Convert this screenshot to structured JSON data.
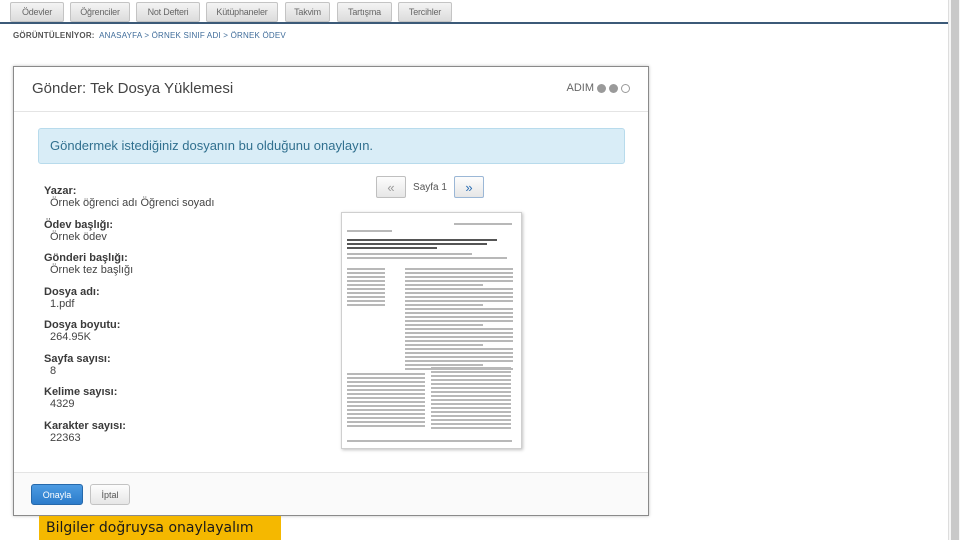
{
  "nav": {
    "tabs": [
      {
        "label": "Ödevler"
      },
      {
        "label": "Öğrenciler"
      },
      {
        "label": "Not Defteri"
      },
      {
        "label": "Kütüphaneler"
      },
      {
        "label": "Takvim"
      },
      {
        "label": "Tartışma"
      },
      {
        "label": "Tercihler"
      }
    ]
  },
  "breadcrumb": {
    "status": "GÖRÜNTÜLENİYOR:",
    "path": "ANASAYFA > ÖRNEK SINIF ADI > ÖRNEK ÖDEV"
  },
  "modal": {
    "title": "Gönder: Tek Dosya Yüklemesi",
    "step_label": "ADIM",
    "step_current": 2,
    "step_total": 3,
    "alert": "Göndermek istediğiniz dosyanın bu olduğunu onaylayın.",
    "fields": [
      {
        "label": "Yazar:",
        "value": "Örnek öğrenci adı Öğrenci soyadı"
      },
      {
        "label": "Ödev başlığı:",
        "value": "Örnek ödev"
      },
      {
        "label": "Gönderi başlığı:",
        "value": "Örnek tez başlığı"
      },
      {
        "label": "Dosya adı:",
        "value": "1.pdf"
      },
      {
        "label": "Dosya boyutu:",
        "value": "264.95K"
      },
      {
        "label": "Sayfa sayısı:",
        "value": "8"
      },
      {
        "label": "Kelime sayısı:",
        "value": "4329"
      },
      {
        "label": "Karakter sayısı:",
        "value": "22363"
      }
    ],
    "pager": {
      "prev": "«",
      "label": "Sayfa 1",
      "next": "»"
    },
    "buttons": {
      "confirm": "Onayla",
      "cancel": "İptal"
    }
  },
  "caption": "Bilgiler doğruysa onaylayalım",
  "colors": {
    "primary": "#2c7ccb",
    "alert_bg": "#d9edf7",
    "alert_text": "#31708f",
    "caption_bg": "#f5b800",
    "nav_border": "#3c5a78"
  }
}
